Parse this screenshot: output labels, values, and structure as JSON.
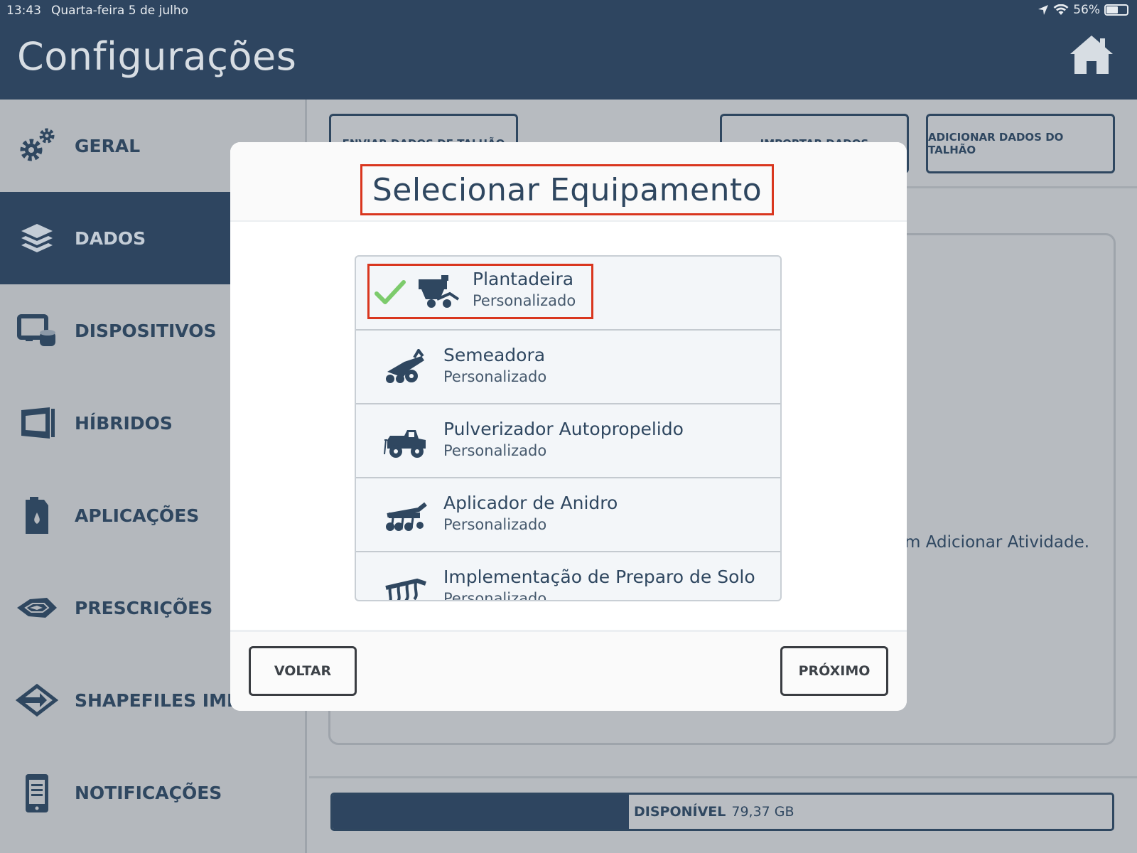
{
  "status_bar": {
    "time": "13:43",
    "date": "Quarta-feira 5 de julho",
    "battery": "56%",
    "battery_level": 0.56
  },
  "header": {
    "title": "Configurações"
  },
  "sidebar": {
    "items": [
      {
        "label": "GERAL",
        "icon": "gears-icon",
        "active": false
      },
      {
        "label": "DADOS",
        "icon": "layers-icon",
        "active": true
      },
      {
        "label": "DISPOSITIVOS",
        "icon": "device-icon",
        "active": false
      },
      {
        "label": "HÍBRIDOS",
        "icon": "seed-bag-icon",
        "active": false
      },
      {
        "label": "APLICAÇÕES",
        "icon": "canister-icon",
        "active": false
      },
      {
        "label": "PRESCRIÇÕES",
        "icon": "prescription-map-icon",
        "active": false
      },
      {
        "label": "SHAPEFILES IMPOR",
        "icon": "shapefile-import-icon",
        "active": false
      },
      {
        "label": "NOTIFICAÇÕES",
        "icon": "phone-notification-icon",
        "active": false
      }
    ]
  },
  "main": {
    "buttons": {
      "send": "ENVIAR DADOS DE TALHÃO",
      "import": "IMPORTAR DADOS",
      "add": "ADICIONAR DADOS DO TALHÃO"
    },
    "activity_hint": "m Adicionar Atividade.",
    "storage": {
      "label": "DISPONÍVEL",
      "value": "79,37 GB",
      "used_fraction": 0.38
    }
  },
  "modal": {
    "title": "Selecionar Equipamento",
    "equipment": [
      {
        "name": "Plantadeira",
        "subtitle": "Personalizado",
        "icon": "planter-icon",
        "selected": true
      },
      {
        "name": "Semeadora",
        "subtitle": "Personalizado",
        "icon": "seeder-icon",
        "selected": false
      },
      {
        "name": "Pulverizador Autopropelido",
        "subtitle": "Personalizado",
        "icon": "sprayer-icon",
        "selected": false
      },
      {
        "name": "Aplicador de Anidro",
        "subtitle": "Personalizado",
        "icon": "anhydrous-applicator-icon",
        "selected": false
      },
      {
        "name": "Implementação de Preparo de Solo",
        "subtitle": "Personalizado",
        "icon": "tillage-icon",
        "selected": false
      }
    ],
    "back_label": "VOLTAR",
    "next_label": "PRÓXIMO"
  },
  "colors": {
    "primary": "#2e4560",
    "highlight": "#d9361e",
    "check": "#7ccb6c"
  }
}
